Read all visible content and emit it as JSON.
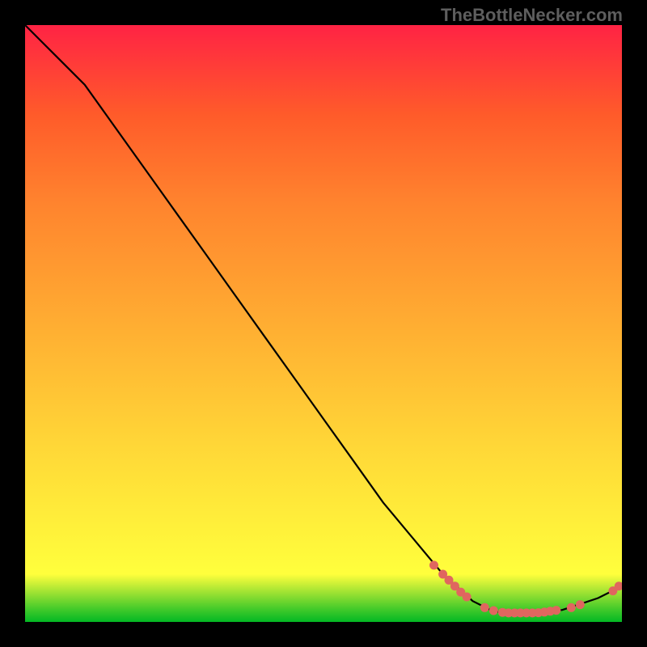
{
  "chart_data": {
    "type": "line",
    "attribution": "TheBottleNecker.com",
    "xlabel": "",
    "ylabel": "",
    "xlim": [
      0,
      100
    ],
    "ylim": [
      0,
      100
    ],
    "background_gradient": {
      "direction": "vertical",
      "stops": [
        {
          "pos": 0,
          "color": "#03b824"
        },
        {
          "pos": 2,
          "color": "#3ec92a"
        },
        {
          "pos": 4,
          "color": "#80da30"
        },
        {
          "pos": 6,
          "color": "#c0ec36"
        },
        {
          "pos": 8,
          "color": "#ffff3c"
        },
        {
          "pos": 30,
          "color": "#ffd637"
        },
        {
          "pos": 50,
          "color": "#ffad32"
        },
        {
          "pos": 70,
          "color": "#ff842e"
        },
        {
          "pos": 85,
          "color": "#ff5b2a"
        },
        {
          "pos": 100,
          "color": "#ff2344"
        }
      ]
    },
    "curve": [
      {
        "x": 0,
        "y": 100
      },
      {
        "x": 3,
        "y": 97
      },
      {
        "x": 6,
        "y": 94
      },
      {
        "x": 10,
        "y": 90
      },
      {
        "x": 15,
        "y": 83
      },
      {
        "x": 20,
        "y": 76
      },
      {
        "x": 25,
        "y": 69
      },
      {
        "x": 30,
        "y": 62
      },
      {
        "x": 35,
        "y": 55
      },
      {
        "x": 40,
        "y": 48
      },
      {
        "x": 45,
        "y": 41
      },
      {
        "x": 50,
        "y": 34
      },
      {
        "x": 55,
        "y": 27
      },
      {
        "x": 60,
        "y": 20
      },
      {
        "x": 65,
        "y": 14
      },
      {
        "x": 70,
        "y": 8
      },
      {
        "x": 75,
        "y": 3.5
      },
      {
        "x": 78,
        "y": 2.0
      },
      {
        "x": 80,
        "y": 1.5
      },
      {
        "x": 85,
        "y": 1.5
      },
      {
        "x": 90,
        "y": 2.0
      },
      {
        "x": 93,
        "y": 3.0
      },
      {
        "x": 96,
        "y": 4.0
      },
      {
        "x": 98,
        "y": 5.0
      },
      {
        "x": 99,
        "y": 5.5
      },
      {
        "x": 100,
        "y": 6.5
      }
    ],
    "dots": {
      "color": "#e0665f",
      "radius": 5.5,
      "points": [
        {
          "x": 68.5,
          "y": 9.5
        },
        {
          "x": 70.0,
          "y": 8.0
        },
        {
          "x": 71.0,
          "y": 7.0
        },
        {
          "x": 72.0,
          "y": 6.0
        },
        {
          "x": 73.0,
          "y": 5.0
        },
        {
          "x": 74.0,
          "y": 4.2
        },
        {
          "x": 77.0,
          "y": 2.4
        },
        {
          "x": 78.5,
          "y": 1.9
        },
        {
          "x": 80.0,
          "y": 1.6
        },
        {
          "x": 81.0,
          "y": 1.5
        },
        {
          "x": 82.0,
          "y": 1.5
        },
        {
          "x": 83.0,
          "y": 1.5
        },
        {
          "x": 84.0,
          "y": 1.5
        },
        {
          "x": 85.0,
          "y": 1.5
        },
        {
          "x": 86.0,
          "y": 1.55
        },
        {
          "x": 87.0,
          "y": 1.65
        },
        {
          "x": 88.0,
          "y": 1.8
        },
        {
          "x": 89.0,
          "y": 1.95
        },
        {
          "x": 91.5,
          "y": 2.4
        },
        {
          "x": 93.0,
          "y": 2.9
        },
        {
          "x": 98.5,
          "y": 5.2
        },
        {
          "x": 99.5,
          "y": 6.0
        }
      ]
    }
  }
}
